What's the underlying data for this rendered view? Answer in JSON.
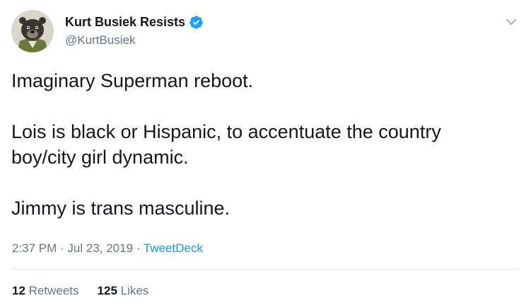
{
  "user": {
    "display_name": "Kurt Busiek Resists",
    "handle": "@KurtBusiek",
    "verified": true,
    "avatar_icon": "bear-avatar-icon"
  },
  "tweet": {
    "paragraphs": [
      "Imaginary Superman reboot.",
      "Lois is black or Hispanic, to accentuate the country boy/city girl dynamic.",
      "Jimmy is trans masculine."
    ]
  },
  "meta": {
    "time": "2:37 PM",
    "separator": " · ",
    "date": "Jul 23, 2019",
    "source": "TweetDeck"
  },
  "stats": {
    "retweets_count": "12",
    "retweets_label": "Retweets",
    "likes_count": "125",
    "likes_label": "Likes"
  },
  "colors": {
    "text": "#14171a",
    "secondary": "#657786",
    "link": "#1b95e0",
    "verified": "#1da1f2",
    "divider": "#e6ecf0"
  }
}
